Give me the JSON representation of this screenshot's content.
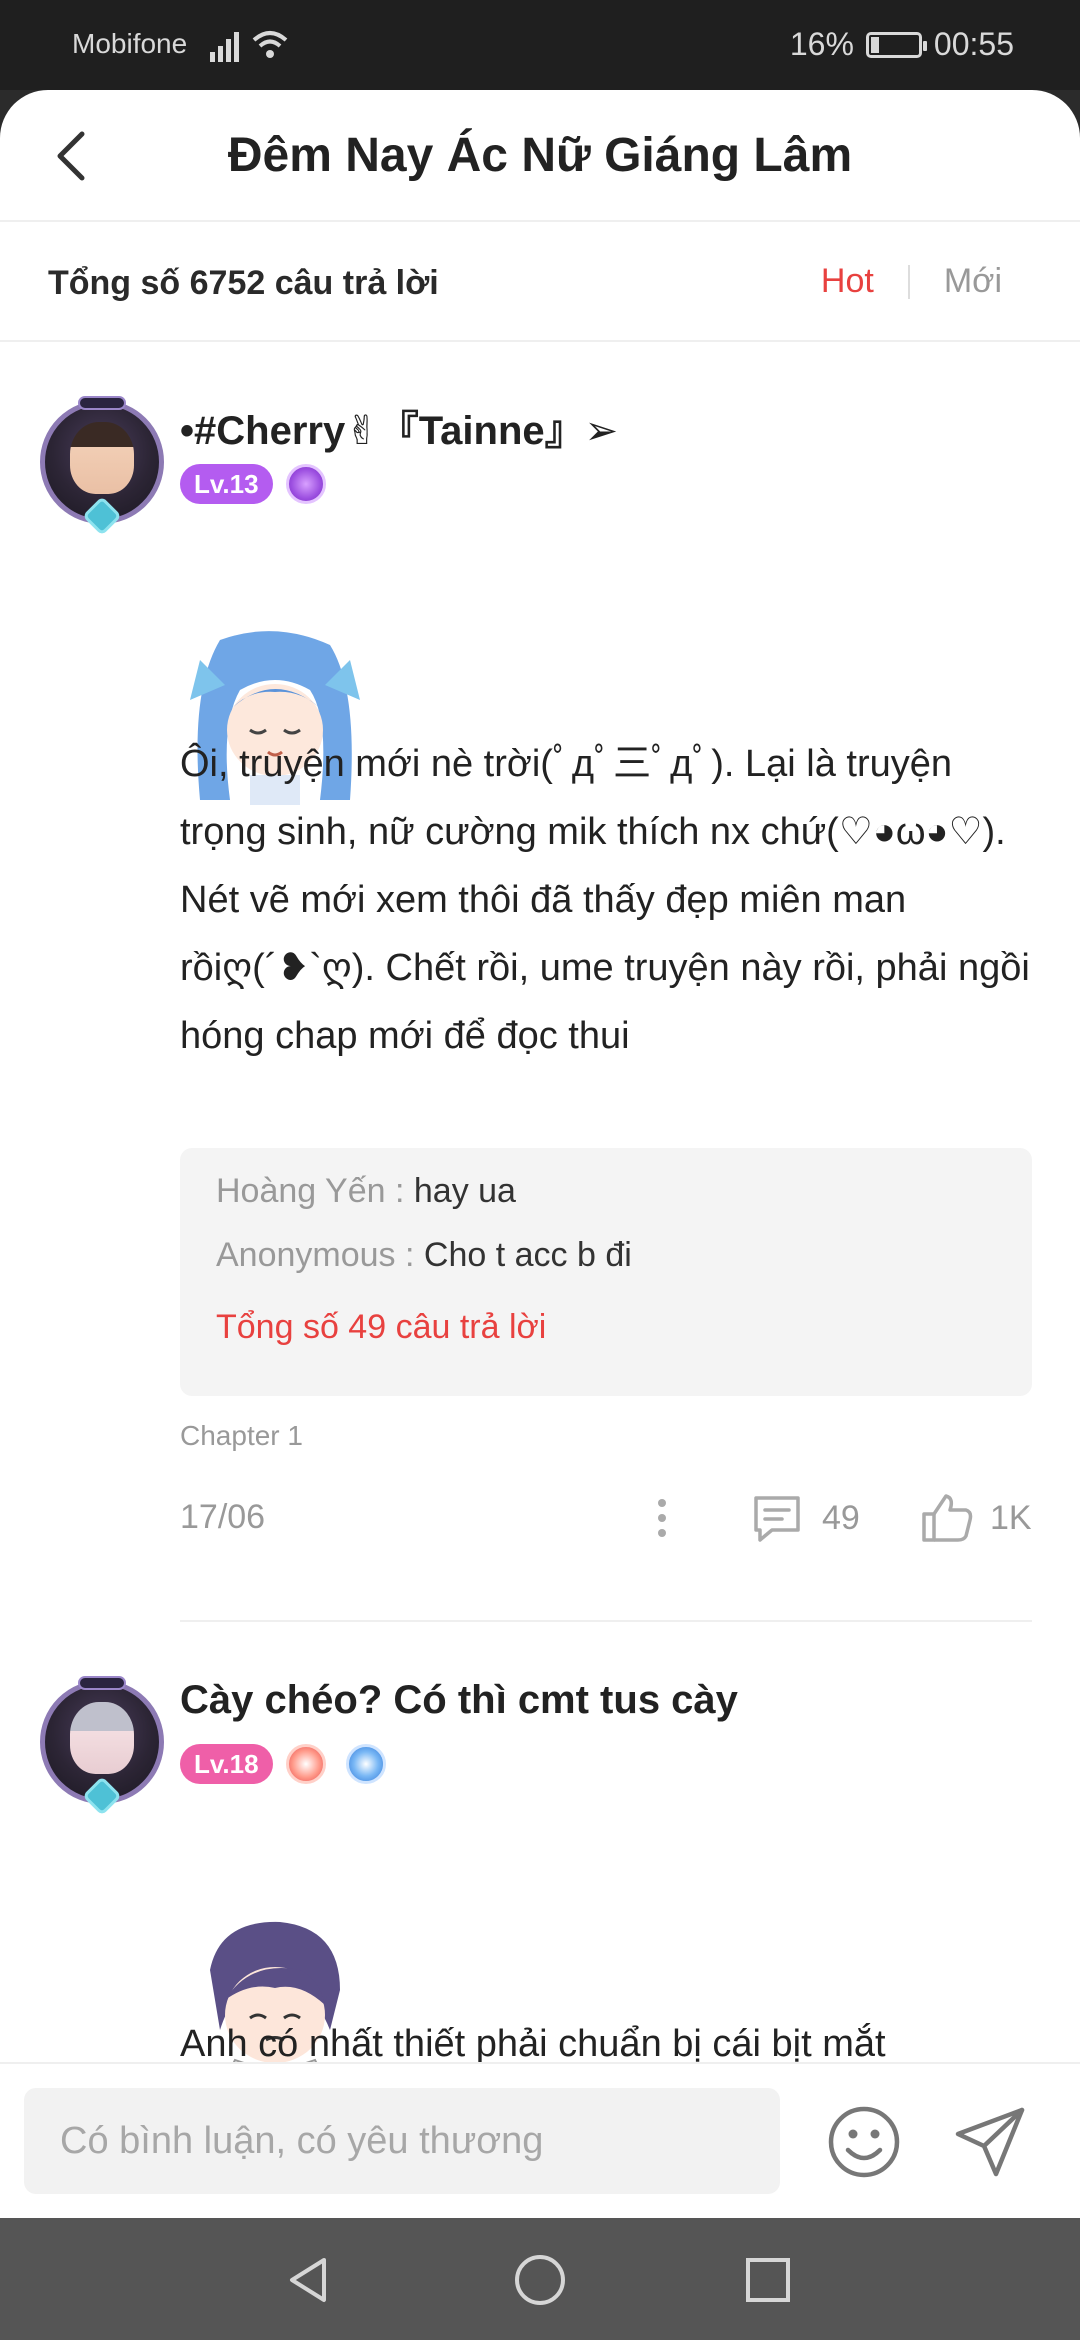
{
  "status_bar": {
    "carrier": "Mobifone",
    "battery": "16%",
    "time": "00:55"
  },
  "header": {
    "title": "Đêm Nay Ác Nữ Giáng Lâm",
    "back_icon": "chevron-left-icon"
  },
  "summary": {
    "total_text": "Tổng số 6752 câu trả lời",
    "sort_hot": "Hot",
    "sort_new": "Mới",
    "accent_color": "#e8413f"
  },
  "comments": [
    {
      "username": "•#Cherry✌『Tainne』➢",
      "level": "Lv.13",
      "level_color": "#b45cf0",
      "content": "Ôi, truyện mới nè trời(ﾟдﾟ三ﾟдﾟ). Lại là truyện trọng sinh, nữ cường mik thích nx chứ(♡◕ω◕♡). Nét vẽ mới xem thôi đã thấy đẹp miên man rồiღ(´❥`ღ). Chết rồi, ume truyện này rồi, phải ngồi hóng chap mới để đọc thui",
      "replies": [
        {
          "name": "Hoàng Yến :",
          "text": "hay ua"
        },
        {
          "name": "Anonymous :",
          "text": "Cho t acc b đi"
        }
      ],
      "replies_total": "Tổng số 49 câu trả lời",
      "chapter": "Chapter 1",
      "date": "17/06",
      "reply_count": "49",
      "like_count": "1K"
    },
    {
      "username": "Cày chéo? Có thì cmt tus cày",
      "level": "Lv.18",
      "level_color": "#ef5fa8",
      "content": "Anh có nhất thiết phải chuẩn bị cái bịt mắt"
    }
  ],
  "input": {
    "placeholder": "Có bình luận, có yêu thương"
  }
}
